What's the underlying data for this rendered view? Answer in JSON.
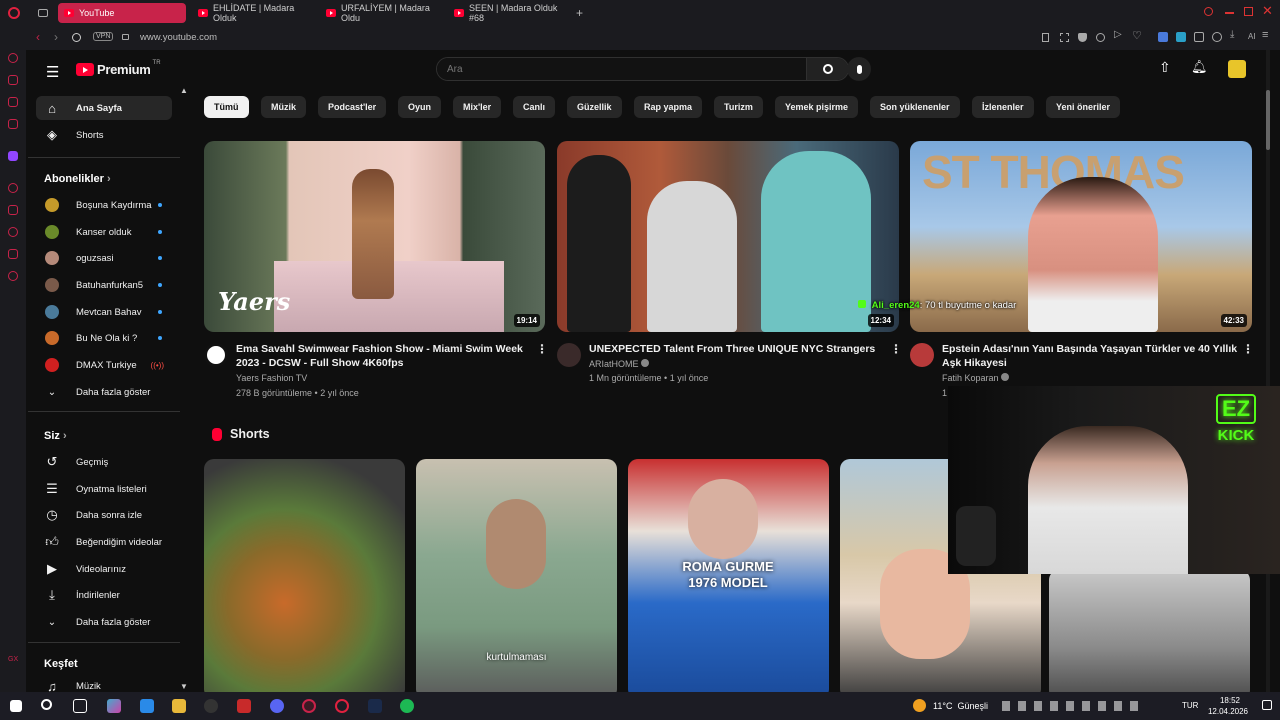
{
  "browser": {
    "tabs": [
      {
        "label": "YouTube",
        "active": true
      },
      {
        "label": "EHLİDATE | Madara Olduk"
      },
      {
        "label": "URFALİYEM | Madara Oldu"
      },
      {
        "label": "SEEN | Madara Olduk #68"
      }
    ],
    "new_tab": "+",
    "url": "www.youtube.com",
    "vpn_label": "VPN",
    "ai_label": "AI"
  },
  "youtube": {
    "logo_text": "Premium",
    "logo_badge": "TR",
    "search_placeholder": "Ara",
    "sidebar": {
      "main": [
        {
          "label": "Ana Sayfa",
          "icon": "home-icon",
          "active": true
        },
        {
          "label": "Shorts",
          "icon": "shorts-icon"
        }
      ],
      "subs_title": "Abonelikler",
      "subs": [
        {
          "label": "Boşuna Kaydırma",
          "color": "#c59a2a",
          "dot": true
        },
        {
          "label": "Kanser olduk",
          "color": "#6a8a2a",
          "dot": true
        },
        {
          "label": "oguzsasi",
          "color": "#b58a7a",
          "dot": true
        },
        {
          "label": "Batuhanfurkan5",
          "color": "#7a5a4a",
          "dot": true
        },
        {
          "label": "Mevtcan Bahav",
          "color": "#4a7a9a",
          "dot": true
        },
        {
          "label": "Bu Ne Ola ki ?",
          "color": "#c86a2a",
          "dot": true
        },
        {
          "label": "DMAX Turkiye",
          "color": "#d02020",
          "live": true
        }
      ],
      "show_more": "Daha fazla göster",
      "you_title": "Siz",
      "you": [
        {
          "label": "Geçmiş",
          "icon": "history-icon"
        },
        {
          "label": "Oynatma listeleri",
          "icon": "playlists-icon"
        },
        {
          "label": "Daha sonra izle",
          "icon": "watch-later-icon"
        },
        {
          "label": "Beğendiğim videolar",
          "icon": "liked-icon"
        },
        {
          "label": "Videolarınız",
          "icon": "your-videos-icon"
        },
        {
          "label": "İndirilenler",
          "icon": "downloads-icon"
        }
      ],
      "show_more2": "Daha fazla göster",
      "explore_title": "Keşfet",
      "explore": [
        {
          "label": "Müzik",
          "icon": "music-icon"
        }
      ]
    },
    "chips": [
      "Tümü",
      "Müzik",
      "Podcast'ler",
      "Oyun",
      "Mix'ler",
      "Canlı",
      "Güzellik",
      "Rap yapma",
      "Turizm",
      "Yemek pişirme",
      "Son yüklenenler",
      "İzlenenler",
      "Yeni öneriler"
    ],
    "videos": [
      {
        "title": "Ema Savahl Swimwear Fashion Show - Miami Swim Week 2023 - DCSW - Full Show 4K60fps",
        "channel": "Yaers Fashion TV",
        "meta": "278 B görüntüleme • 2 yıl önce",
        "duration": "19:14",
        "thumb_text": "Yaers",
        "verified": false
      },
      {
        "title": "UNEXPECTED Talent From Three UNIQUE NYC Strangers",
        "channel": "ARIatHOME",
        "meta": "1 Mn görüntüleme • 1 yıl önce",
        "duration": "12:34",
        "thumb_text": "",
        "verified": true
      },
      {
        "title": "Epstein Adası'nın Yanı Başında Yaşayan Türkler ve 40 Yıllık Aşk Hikayesi",
        "channel": "Fatih Koparan",
        "meta": "1",
        "duration": "42:33",
        "thumb_text": "ST THOMAS",
        "verified": true
      }
    ],
    "overlay_chat": {
      "user": "Ali_eren24",
      "message": ": 70 tl buyutme o kadar"
    },
    "shorts_title": "Shorts",
    "shorts": [
      {
        "caption": ""
      },
      {
        "caption": "kurtulmaması"
      },
      {
        "caption": "ROMA GURME 1976 MODEL"
      },
      {
        "caption": ""
      }
    ],
    "webcam": {
      "badge_line1": "EZ",
      "badge_line2": "KICK"
    }
  },
  "taskbar": {
    "weather": "11°C  Güneşli",
    "lang": "TUR",
    "time": "18:52",
    "date": "12.04.2026"
  }
}
